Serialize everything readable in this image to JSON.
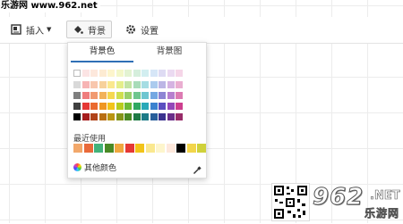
{
  "watermark": "乐游网 www.962.net",
  "toolbar": {
    "insert_label": "插入",
    "background_label": "背景",
    "settings_label": "设置"
  },
  "panel": {
    "tabs": [
      "背景色",
      "背景图"
    ],
    "active_tab": "背景色",
    "palette": [
      [
        "#ffffff",
        "#fce4e4",
        "#fde8dc",
        "#fdebd2",
        "#fdf5cc",
        "#f3f7c9",
        "#e3f3d2",
        "#d5eedc",
        "#d2eef0",
        "#d6e6f7",
        "#dedbf3",
        "#ebdaf1",
        "#f5d6e8"
      ],
      [
        "#d9d9d9",
        "#f7b4b4",
        "#f8c7ad",
        "#f7d19b",
        "#fae88f",
        "#e4ee8b",
        "#c3e4a4",
        "#a9dcb9",
        "#a5dde3",
        "#abcbee",
        "#bcb6e5",
        "#d5b3e2",
        "#eaaed1"
      ],
      [
        "#7f7f7f",
        "#ef7d7d",
        "#f19a70",
        "#f2b25a",
        "#f5d851",
        "#cfdf4f",
        "#9ad06b",
        "#6fc68e",
        "#6ec6d0",
        "#74a8e2",
        "#8d85d4",
        "#b67fcf",
        "#dc7bb3"
      ],
      [
        "#404040",
        "#e53935",
        "#ea6a2f",
        "#ef9722",
        "#f2c419",
        "#b7cc1d",
        "#6cbb36",
        "#2fa861",
        "#29a9b8",
        "#3b82cf",
        "#5a4fc0",
        "#9347b8",
        "#cd3f8f"
      ],
      [
        "#000000",
        "#a61e1e",
        "#b0441a",
        "#b86e12",
        "#b99511",
        "#84951a",
        "#4a8a25",
        "#1f7a45",
        "#1d7b87",
        "#295f9b",
        "#3b338f",
        "#6a2f89",
        "#982c69"
      ]
    ],
    "recent_label": "最近使用",
    "recent_colors": [
      "#f2a86b",
      "#e96a3a",
      "#43b37a",
      "#4a8a25",
      "#f0a840",
      "#e53935",
      "#f2c419",
      "#fae88f",
      "#fdf5cc",
      "#fde8dc",
      "#000000",
      "#f2d54a",
      "#cfd13a"
    ],
    "more_colors_label": "其他颜色",
    "more_colors_icon": "color-wheel-icon",
    "eyedropper_icon": "eyedropper-icon"
  },
  "logo": {
    "main": "962",
    "net": ".NET",
    "sub": "乐游网"
  }
}
